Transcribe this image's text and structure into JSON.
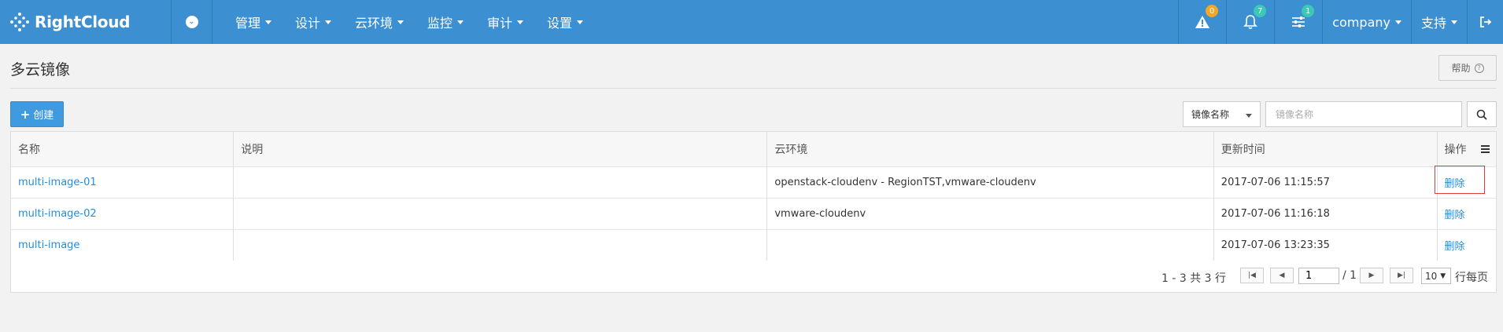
{
  "app": {
    "logo_text": "RightCloud"
  },
  "nav": {
    "menu": [
      {
        "label": "管理"
      },
      {
        "label": "设计"
      },
      {
        "label": "云环境"
      },
      {
        "label": "监控"
      },
      {
        "label": "审计"
      },
      {
        "label": "设置"
      }
    ],
    "alerts_badge": "0",
    "notifications_badge": "7",
    "tasks_badge": "1",
    "company_label": "company",
    "support_label": "支持"
  },
  "page": {
    "title": "多云镜像",
    "help_label": "帮助",
    "create_label": "创建",
    "filter_selected": "镜像名称",
    "search_placeholder": "镜像名称"
  },
  "table": {
    "columns": [
      "名称",
      "说明",
      "云环境",
      "更新时间",
      "操作"
    ],
    "rows": [
      {
        "name": "multi-image-01",
        "desc": "",
        "cloud": "openstack-cloudenv - RegionTST,vmware-cloudenv",
        "updated": "2017-07-06 11:15:57",
        "action": "删除"
      },
      {
        "name": "multi-image-02",
        "desc": "",
        "cloud": "vmware-cloudenv",
        "updated": "2017-07-06 11:16:18",
        "action": "删除"
      },
      {
        "name": "multi-image",
        "desc": "",
        "cloud": "",
        "updated": "2017-07-06 13:23:35",
        "action": "删除"
      }
    ]
  },
  "pagination": {
    "summary": "1 - 3 共 3 行",
    "current_page": "1",
    "total_pages": "/ 1",
    "page_size": "10",
    "page_size_label": "行每页"
  },
  "colors": {
    "nav_bg": "#3c8fd0",
    "link": "#1f8ee0",
    "primary_button": "#3f9ae0",
    "highlight": "#e23b3b"
  }
}
